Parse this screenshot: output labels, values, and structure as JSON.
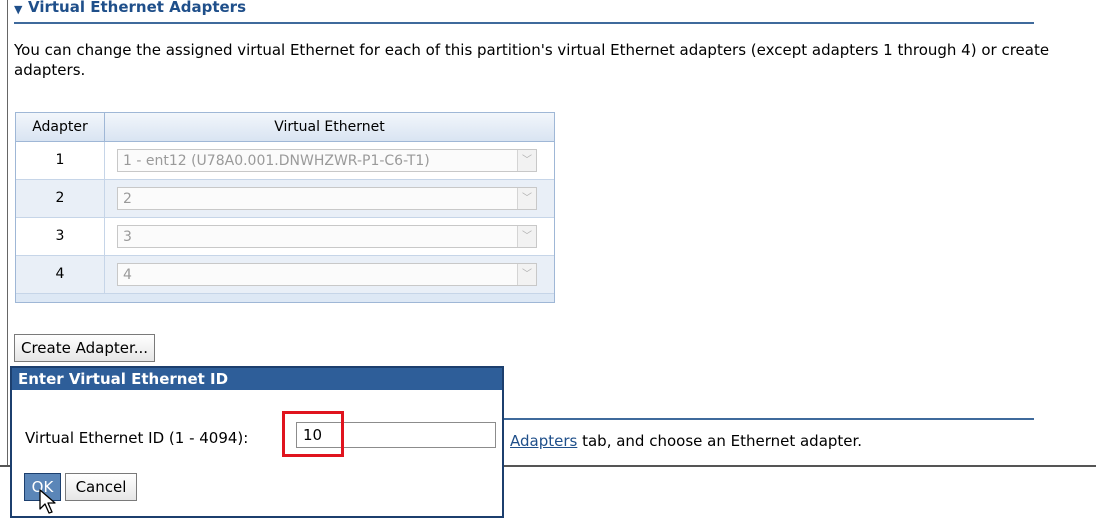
{
  "section": {
    "title": "Virtual Ethernet Adapters",
    "description": "You can change the assigned virtual Ethernet for each of this partition's virtual Ethernet adapters (except adapters 1 through 4) or create adapters."
  },
  "table": {
    "headers": [
      "Adapter",
      "Virtual Ethernet"
    ],
    "rows": [
      {
        "adapter": "1",
        "virtual_ethernet": "1 - ent12 (U78A0.001.DNWHZWR-P1-C6-T1)"
      },
      {
        "adapter": "2",
        "virtual_ethernet": "2"
      },
      {
        "adapter": "3",
        "virtual_ethernet": "3"
      },
      {
        "adapter": "4",
        "virtual_ethernet": "4"
      }
    ]
  },
  "create_button": "Create Adapter...",
  "background_text": {
    "link": "Adapters",
    "rest": " tab, and choose an Ethernet adapter."
  },
  "popup": {
    "title": "Enter Virtual Ethernet ID",
    "field_label": "Virtual Ethernet ID (1 - 4094):",
    "field_value": "10",
    "ok_label": "OK",
    "cancel_label": "Cancel"
  },
  "icons": {
    "collapse": "triangle-down-icon",
    "dropdown": "chevron-down-icon",
    "cursor": "mouse-pointer-icon"
  },
  "colors": {
    "header_text": "#1f4f8a",
    "popup_title_bg": "#2e5e99",
    "highlight": "#e0141e"
  }
}
